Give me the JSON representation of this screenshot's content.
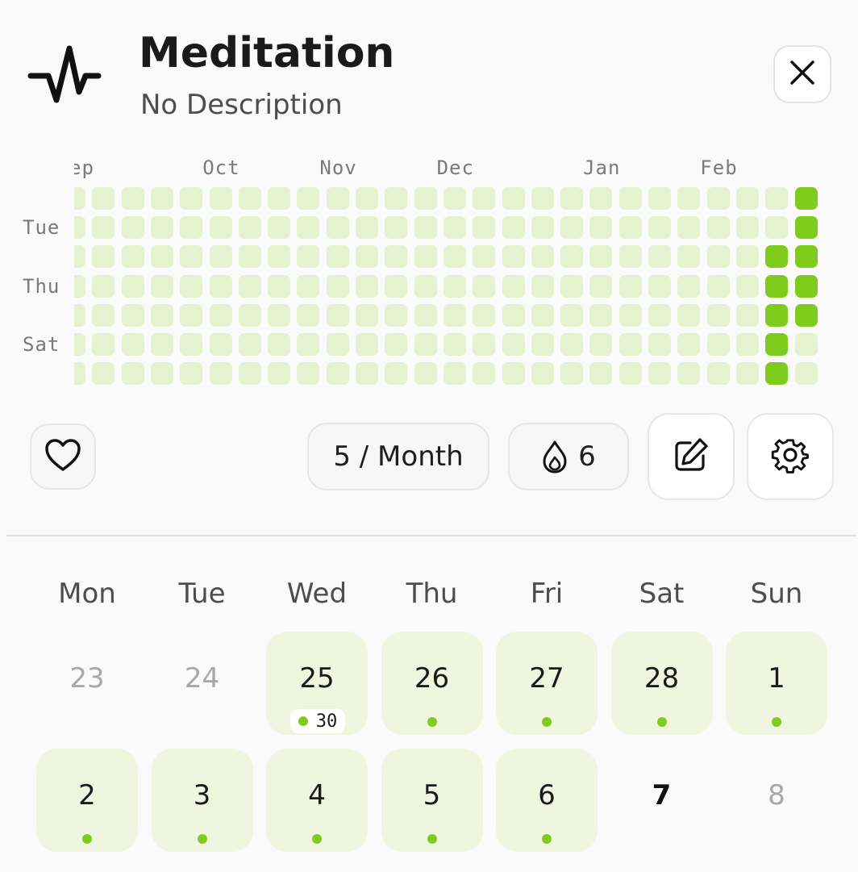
{
  "colors": {
    "bg": "#fafafa",
    "cell_empty": "#e6f1cf",
    "cell_done": "#7fcc1e",
    "day_done_bg": "#f0f5df"
  },
  "header": {
    "title": "Meditation",
    "subtitle": "No Description",
    "app_icon": "activity-pulse-icon",
    "close_icon": "close-icon"
  },
  "heatmap": {
    "months": [
      {
        "label": "ep",
        "col": 0
      },
      {
        "label": "Oct",
        "col": 4
      },
      {
        "label": "Nov",
        "col": 8
      },
      {
        "label": "Dec",
        "col": 12
      },
      {
        "label": "Jan",
        "col": 17
      },
      {
        "label": "Feb",
        "col": 21
      }
    ],
    "day_labels": [
      {
        "label": "Tue",
        "row": 1
      },
      {
        "label": "Thu",
        "row": 3
      },
      {
        "label": "Sat",
        "row": 5
      }
    ],
    "columns": 26,
    "rows": 7,
    "done_cells": [
      [
        24,
        2
      ],
      [
        24,
        3
      ],
      [
        24,
        4
      ],
      [
        24,
        5
      ],
      [
        24,
        6
      ],
      [
        25,
        0
      ],
      [
        25,
        1
      ],
      [
        25,
        2
      ],
      [
        25,
        3
      ],
      [
        25,
        4
      ]
    ]
  },
  "actions": {
    "favorite_icon": "heart-icon",
    "frequency_label": "5 / Month",
    "streak_icon": "flame-drop-icon",
    "streak_value": "6",
    "edit_icon": "edit-icon",
    "settings_icon": "gear-icon"
  },
  "calendar": {
    "weekdays": [
      "Mon",
      "Tue",
      "Wed",
      "Thu",
      "Fri",
      "Sat",
      "Sun"
    ],
    "weeks": [
      [
        {
          "day": "23",
          "state": "muted"
        },
        {
          "day": "24",
          "state": "muted"
        },
        {
          "day": "25",
          "state": "done",
          "count": "30"
        },
        {
          "day": "26",
          "state": "done"
        },
        {
          "day": "27",
          "state": "done"
        },
        {
          "day": "28",
          "state": "done"
        },
        {
          "day": "1",
          "state": "done"
        }
      ],
      [
        {
          "day": "2",
          "state": "done"
        },
        {
          "day": "3",
          "state": "done"
        },
        {
          "day": "4",
          "state": "done"
        },
        {
          "day": "5",
          "state": "done"
        },
        {
          "day": "6",
          "state": "done"
        },
        {
          "day": "7",
          "state": "today"
        },
        {
          "day": "8",
          "state": "muted"
        }
      ]
    ]
  }
}
